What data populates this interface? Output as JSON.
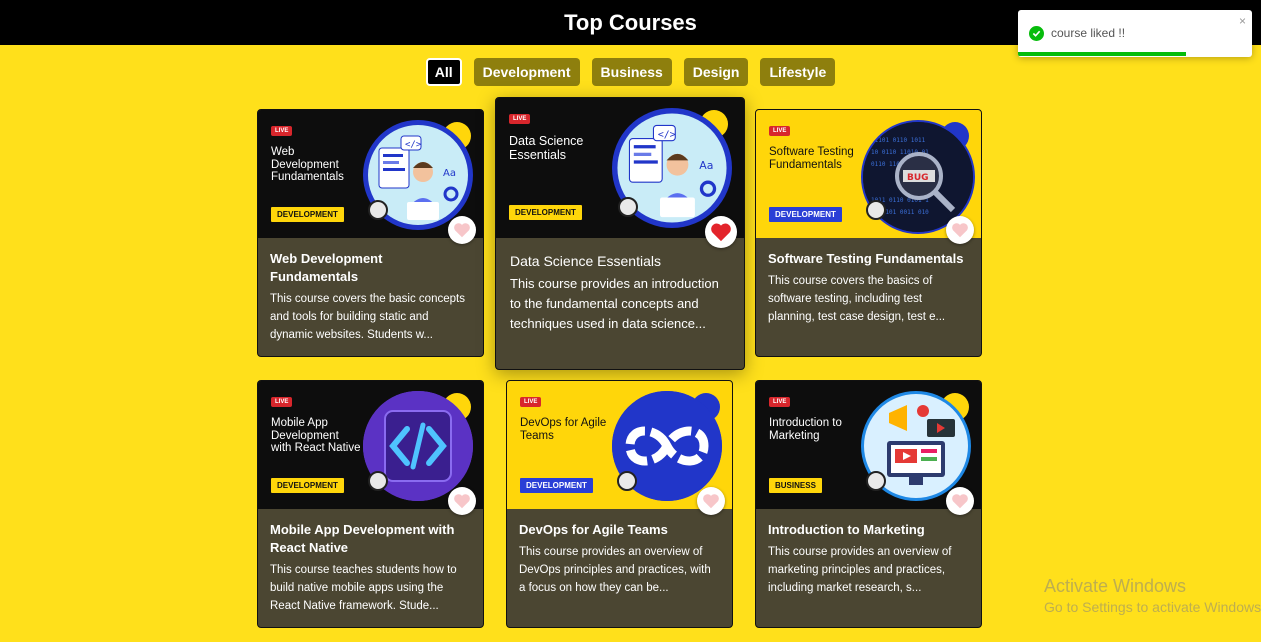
{
  "header": {
    "title": "Top Courses"
  },
  "filters": [
    {
      "label": "All",
      "active": true
    },
    {
      "label": "Development",
      "active": false
    },
    {
      "label": "Business",
      "active": false
    },
    {
      "label": "Design",
      "active": false
    },
    {
      "label": "Lifestyle",
      "active": false
    }
  ],
  "courses": [
    {
      "thumb_title": "Web Development Fundamentals",
      "badge": "DEVELOPMENT",
      "live": "LIVE",
      "title": "Web Development Fundamentals",
      "description": "This course covers the basic concepts and tools for building static and dynamic websites. Students w...",
      "liked": false
    },
    {
      "thumb_title": "Data Science Essentials",
      "badge": "DEVELOPMENT",
      "live": "LIVE",
      "title": "Data Science Essentials",
      "description": "This course provides an introduction to the fundamental concepts and techniques used in data science...",
      "liked": true
    },
    {
      "thumb_title": "Software Testing Fundamentals",
      "badge": "DEVELOPMENT",
      "live": "LIVE",
      "title": "Software Testing Fundamentals",
      "description": "This course covers the basics of software testing, including test planning, test case design, test e...",
      "liked": false
    },
    {
      "thumb_title": "Mobile App Development with React Native",
      "badge": "DEVELOPMENT",
      "live": "LIVE",
      "title": "Mobile App Development with React Native",
      "description": "This course teaches students how to build native mobile apps using the React Native framework. Stude...",
      "liked": false
    },
    {
      "thumb_title": "DevOps for Agile Teams",
      "badge": "DEVELOPMENT",
      "live": "LIVE",
      "title": "DevOps for Agile Teams",
      "description": "This course provides an overview of DevOps principles and practices, with a focus on how they can be...",
      "liked": false
    },
    {
      "thumb_title": "Introduction to Marketing",
      "badge": "BUSINESS",
      "live": "LIVE",
      "title": "Introduction to Marketing",
      "description": "This course provides an overview of marketing principles and practices, including market research, s...",
      "liked": false
    }
  ],
  "toast": {
    "message": "course liked !!",
    "close": "×",
    "progress": 0.72
  },
  "watermark": {
    "line1": "Activate Windows",
    "line2": "Go to Settings to activate Windows."
  },
  "colors": {
    "background": "#ffe01b",
    "card": "#4b4632",
    "liked": "#e3242b",
    "unliked": "#f7c6c9",
    "toast_success": "#07bc0c"
  }
}
